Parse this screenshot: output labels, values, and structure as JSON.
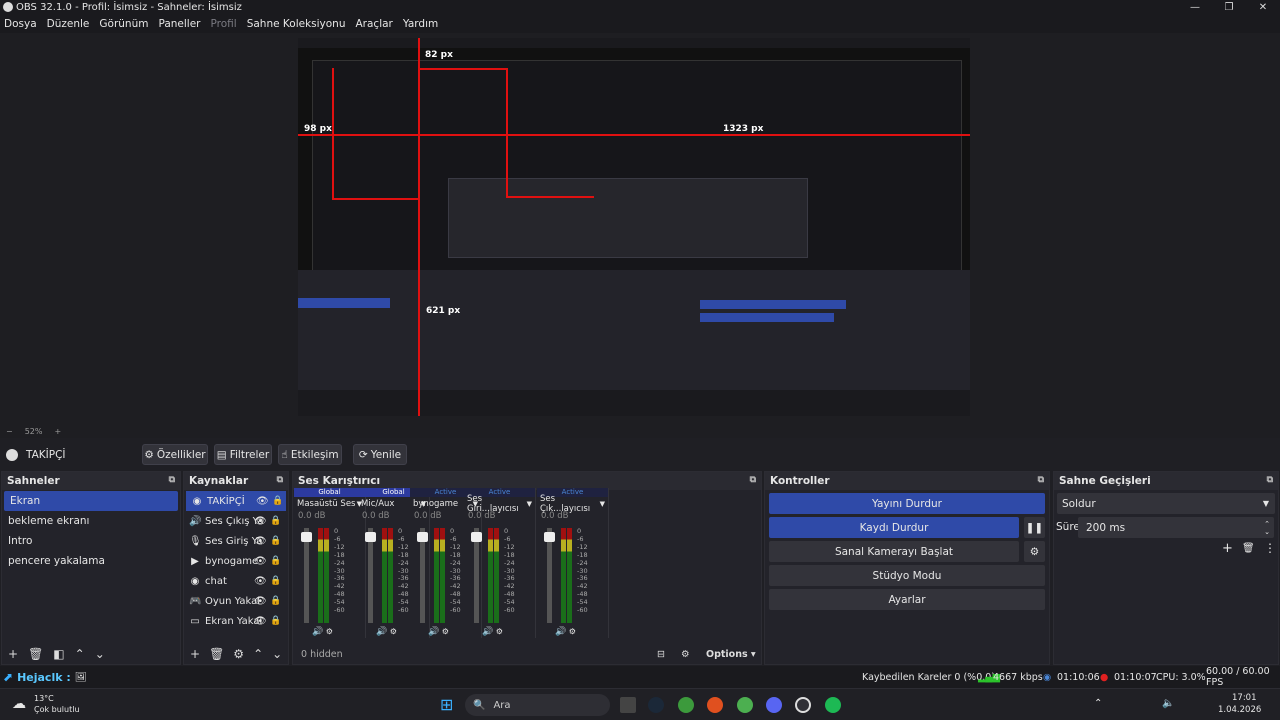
{
  "window": {
    "title": "OBS 32.1.0 - Profil: İsimsiz - Sahneler: İsimsiz",
    "min": "—",
    "max": "❐",
    "close": "✕"
  },
  "menu": [
    "Dosya",
    "Düzenle",
    "Görünüm",
    "Paneller",
    "Profil",
    "Sahne Koleksiyonu",
    "Araçlar",
    "Yardım"
  ],
  "preview": {
    "labels": [
      "82 px",
      "98 px",
      "1323 px",
      "621 px"
    ],
    "zoom": "52%"
  },
  "source_bar": {
    "selected": "TAKİPÇİ",
    "props": "Özellikler",
    "filters": "Filtreler",
    "interact": "Etkileşim",
    "refresh": "Yenile"
  },
  "scenes": {
    "title": "Sahneler",
    "items": [
      "Ekran",
      "bekleme ekranı",
      "Intro",
      "pencere yakalama"
    ]
  },
  "sources": {
    "title": "Kaynaklar",
    "items": [
      "TAKİPÇİ",
      "Ses Çıkış Ya",
      "Ses Giriş Ya",
      "bynogame",
      "chat",
      "Oyun Yakal",
      "Ekran Yakal"
    ]
  },
  "mixer": {
    "title": "Ses Karıştırıcı",
    "hidden": "0 hidden",
    "options": "Options",
    "channels": [
      {
        "tag": "Global",
        "name": "Masaüstü Ses",
        "db": "0.0 dB"
      },
      {
        "tag": "Global",
        "name": "Mic/Aux",
        "db": "0.0 dB"
      },
      {
        "tag": "Active",
        "name": "bynogame",
        "db": "0.0 dB"
      },
      {
        "tag": "Active",
        "name": "Ses Giri...layıcısı",
        "db": "0.0 dB"
      },
      {
        "tag": "Active",
        "name": "Ses Çık...layıcısı",
        "db": "0.0 dB"
      }
    ],
    "scale": [
      "0",
      "-6",
      "-12",
      "-18",
      "-24",
      "-30",
      "-36",
      "-42",
      "-48",
      "-54",
      "-60"
    ]
  },
  "controls": {
    "title": "Kontroller",
    "stream": "Yayını Durdur",
    "record": "Kaydı Durdur",
    "vcam": "Sanal Kamerayı Başlat",
    "studio": "Stüdyo Modu",
    "settings": "Ayarlar"
  },
  "transitions": {
    "title": "Sahne Geçişleri",
    "type": "Soldur",
    "duration_label": "Süre",
    "duration": "200 ms"
  },
  "status": {
    "dropped": "Kaybedilen Kareler 0 (%0.0)",
    "bitrate": "4667 kbps",
    "stream_time": "01:10:06",
    "rec_time": "01:10:07",
    "cpu": "CPU: 3.0%",
    "fps": "60.00 / 60.00 FPS"
  },
  "hejaclk": "Hejaclk :",
  "taskbar": {
    "temp": "13°C",
    "weather": "Çok bulutlu",
    "search": "Ara",
    "time": "17:01",
    "date": "1.04.2026"
  }
}
